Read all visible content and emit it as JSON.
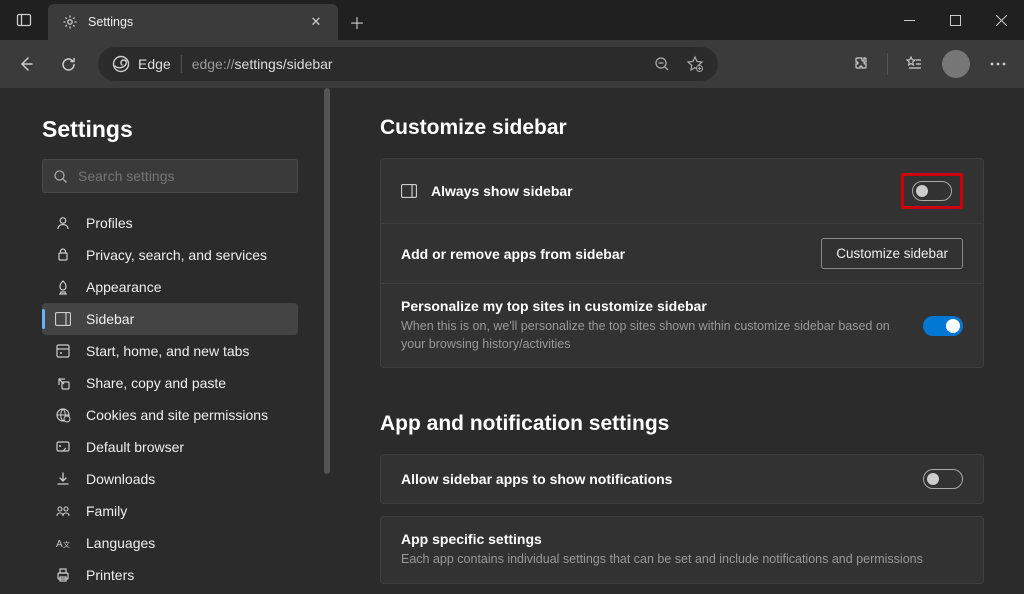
{
  "titlebar": {
    "tab_title": "Settings"
  },
  "toolbar": {
    "edge_label": "Edge",
    "url_prefix": "edge://",
    "url_rest": "settings/sidebar"
  },
  "sidebar": {
    "heading": "Settings",
    "search_placeholder": "Search settings",
    "items": [
      {
        "label": "Profiles",
        "active": false
      },
      {
        "label": "Privacy, search, and services",
        "active": false
      },
      {
        "label": "Appearance",
        "active": false
      },
      {
        "label": "Sidebar",
        "active": true
      },
      {
        "label": "Start, home, and new tabs",
        "active": false
      },
      {
        "label": "Share, copy and paste",
        "active": false
      },
      {
        "label": "Cookies and site permissions",
        "active": false
      },
      {
        "label": "Default browser",
        "active": false
      },
      {
        "label": "Downloads",
        "active": false
      },
      {
        "label": "Family",
        "active": false
      },
      {
        "label": "Languages",
        "active": false
      },
      {
        "label": "Printers",
        "active": false
      }
    ]
  },
  "main": {
    "section1_heading": "Customize sidebar",
    "always_show_label": "Always show sidebar",
    "addremove_label": "Add or remove apps from sidebar",
    "customize_button": "Customize sidebar",
    "personalize_label": "Personalize my top sites in customize sidebar",
    "personalize_desc": "When this is on, we'll personalize the top sites shown within customize sidebar based on your browsing history/activities",
    "section2_heading": "App and notification settings",
    "allow_notif_label": "Allow sidebar apps to show notifications",
    "app_specific_label": "App specific settings",
    "app_specific_desc": "Each app contains individual settings that can be set and include notifications and permissions"
  }
}
